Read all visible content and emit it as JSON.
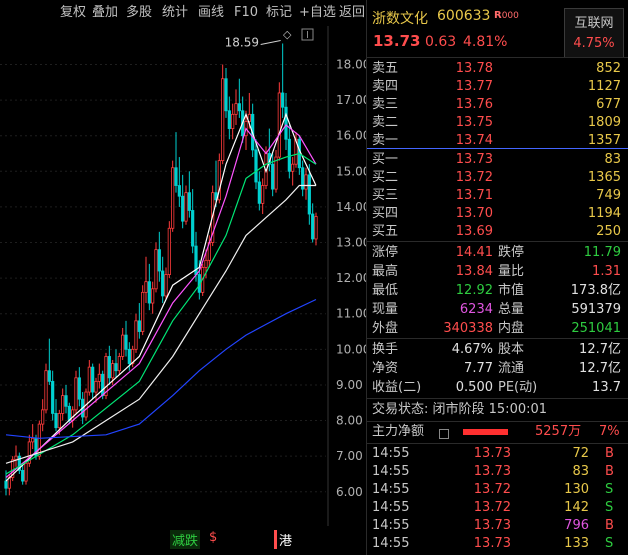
{
  "toolbar": {
    "items": [
      "复权",
      "叠加",
      "多股",
      "统计",
      "画线",
      "F10",
      "标记",
      "+自选",
      "返回"
    ]
  },
  "chart": {
    "max_label": "18.59",
    "y_ticks": [
      "18.00",
      "17.00",
      "16.00",
      "15.00",
      "14.00",
      "13.00",
      "12.00",
      "11.00",
      "10.00",
      "9.00",
      "8.00",
      "7.00",
      "6.00"
    ],
    "indicators": [
      "减跌",
      "$",
      "港"
    ]
  },
  "chart_data": {
    "type": "candlestick",
    "ylim": [
      5.6,
      18.8
    ],
    "ohlc": [
      [
        6.3,
        6.6,
        5.9,
        6.1
      ],
      [
        6.1,
        6.5,
        5.9,
        6.4
      ],
      [
        6.4,
        7.0,
        6.3,
        6.9
      ],
      [
        6.9,
        7.3,
        6.7,
        7.0
      ],
      [
        7.0,
        7.1,
        6.5,
        6.6
      ],
      [
        6.6,
        6.8,
        6.2,
        6.3
      ],
      [
        6.3,
        6.9,
        6.2,
        6.8
      ],
      [
        6.8,
        7.6,
        6.7,
        7.4
      ],
      [
        7.4,
        7.9,
        7.2,
        7.5
      ],
      [
        7.5,
        7.6,
        6.9,
        7.0
      ],
      [
        7.0,
        8.0,
        6.9,
        7.9
      ],
      [
        7.9,
        8.6,
        7.7,
        8.3
      ],
      [
        8.3,
        9.6,
        8.2,
        9.4
      ],
      [
        9.4,
        10.3,
        9.0,
        9.1
      ],
      [
        9.1,
        9.4,
        8.0,
        8.2
      ],
      [
        8.2,
        8.6,
        7.7,
        7.8
      ],
      [
        7.8,
        8.3,
        7.6,
        8.2
      ],
      [
        8.2,
        8.9,
        8.0,
        8.7
      ],
      [
        8.7,
        9.0,
        8.2,
        8.4
      ],
      [
        8.4,
        8.5,
        7.9,
        8.0
      ],
      [
        8.0,
        8.4,
        7.8,
        8.3
      ],
      [
        8.3,
        9.4,
        8.2,
        9.2
      ],
      [
        9.2,
        9.5,
        8.4,
        8.6
      ],
      [
        8.6,
        8.8,
        7.9,
        8.1
      ],
      [
        8.1,
        8.9,
        8.0,
        8.8
      ],
      [
        8.8,
        9.7,
        8.7,
        9.5
      ],
      [
        9.5,
        9.6,
        8.6,
        8.8
      ],
      [
        8.8,
        9.2,
        8.5,
        9.1
      ],
      [
        9.1,
        9.6,
        8.9,
        9.3
      ],
      [
        9.3,
        9.4,
        8.6,
        8.7
      ],
      [
        8.7,
        9.9,
        8.6,
        9.8
      ],
      [
        9.8,
        10.1,
        9.0,
        9.2
      ],
      [
        9.2,
        9.7,
        9.0,
        9.6
      ],
      [
        9.6,
        10.0,
        9.2,
        9.4
      ],
      [
        9.4,
        9.9,
        9.3,
        9.8
      ],
      [
        9.8,
        10.6,
        9.7,
        10.4
      ],
      [
        10.4,
        10.8,
        9.8,
        10.0
      ],
      [
        10.0,
        10.2,
        9.4,
        9.6
      ],
      [
        9.6,
        10.1,
        9.5,
        10.0
      ],
      [
        10.0,
        11.0,
        9.9,
        10.8
      ],
      [
        10.8,
        11.3,
        10.3,
        10.5
      ],
      [
        10.5,
        11.8,
        10.4,
        11.6
      ],
      [
        11.6,
        12.6,
        11.3,
        11.9
      ],
      [
        11.9,
        12.4,
        11.1,
        11.3
      ],
      [
        11.3,
        11.9,
        11.0,
        11.7
      ],
      [
        11.7,
        13.0,
        11.6,
        12.8
      ],
      [
        12.8,
        13.3,
        11.9,
        12.2
      ],
      [
        12.2,
        12.6,
        11.3,
        11.5
      ],
      [
        11.5,
        12.3,
        11.4,
        12.1
      ],
      [
        12.1,
        13.6,
        12.0,
        13.4
      ],
      [
        13.4,
        15.3,
        13.3,
        15.1
      ],
      [
        15.1,
        16.1,
        14.4,
        14.6
      ],
      [
        14.6,
        15.4,
        14.0,
        14.3
      ],
      [
        14.3,
        14.9,
        13.4,
        13.6
      ],
      [
        13.6,
        14.6,
        13.5,
        14.4
      ],
      [
        14.4,
        15.0,
        13.7,
        13.9
      ],
      [
        13.9,
        14.5,
        12.7,
        12.9
      ],
      [
        12.9,
        13.3,
        11.9,
        12.1
      ],
      [
        12.1,
        12.5,
        11.4,
        11.6
      ],
      [
        11.6,
        12.4,
        11.5,
        12.3
      ],
      [
        12.3,
        12.8,
        12.0,
        12.5
      ],
      [
        12.5,
        13.2,
        12.3,
        13.0
      ],
      [
        13.0,
        14.6,
        12.9,
        14.4
      ],
      [
        14.4,
        15.3,
        14.0,
        14.2
      ],
      [
        14.2,
        15.5,
        14.1,
        15.3
      ],
      [
        15.3,
        18.0,
        15.2,
        17.6
      ],
      [
        17.6,
        17.9,
        16.5,
        16.7
      ],
      [
        16.7,
        17.1,
        15.9,
        16.2
      ],
      [
        16.2,
        16.9,
        15.9,
        16.6
      ],
      [
        16.6,
        17.3,
        16.3,
        16.9
      ],
      [
        16.9,
        17.6,
        16.5,
        16.7
      ],
      [
        16.7,
        17.1,
        15.8,
        16.0
      ],
      [
        16.0,
        16.7,
        15.6,
        16.4
      ],
      [
        16.4,
        17.2,
        16.2,
        16.6
      ],
      [
        16.6,
        16.9,
        15.4,
        15.6
      ],
      [
        15.6,
        15.9,
        14.5,
        14.7
      ],
      [
        14.7,
        15.0,
        13.9,
        14.1
      ],
      [
        14.1,
        14.8,
        13.8,
        14.6
      ],
      [
        14.6,
        15.7,
        14.5,
        15.5
      ],
      [
        15.5,
        16.2,
        15.0,
        15.2
      ],
      [
        15.2,
        15.5,
        14.3,
        14.5
      ],
      [
        14.5,
        15.6,
        14.4,
        15.4
      ],
      [
        15.4,
        17.5,
        15.3,
        17.2
      ],
      [
        17.2,
        18.59,
        16.5,
        16.8
      ],
      [
        16.8,
        17.2,
        15.6,
        15.9
      ],
      [
        15.9,
        16.3,
        14.8,
        15.0
      ],
      [
        15.0,
        15.4,
        14.6,
        15.2
      ],
      [
        15.2,
        16.1,
        15.1,
        15.9
      ],
      [
        15.9,
        16.0,
        14.9,
        15.1
      ],
      [
        15.1,
        15.3,
        14.3,
        14.5
      ],
      [
        14.5,
        15.1,
        14.2,
        14.9
      ],
      [
        14.9,
        15.2,
        13.5,
        13.8
      ],
      [
        13.8,
        14.1,
        13.0,
        13.1
      ],
      [
        13.1,
        13.84,
        12.92,
        13.73
      ]
    ],
    "ma": [
      {
        "color": "#ffffff",
        "values": [
          [
            0,
            6.3
          ],
          [
            20,
            8.1
          ],
          [
            40,
            9.8
          ],
          [
            50,
            11.8
          ],
          [
            58,
            12.3
          ],
          [
            66,
            15.2
          ],
          [
            72,
            16.6
          ],
          [
            78,
            15.0
          ],
          [
            84,
            16.6
          ],
          [
            88,
            15.6
          ],
          [
            93,
            14.6
          ]
        ]
      },
      {
        "color": "#ff55ff",
        "values": [
          [
            0,
            6.4
          ],
          [
            20,
            8.0
          ],
          [
            40,
            9.6
          ],
          [
            50,
            11.3
          ],
          [
            58,
            12.2
          ],
          [
            66,
            14.3
          ],
          [
            72,
            16.2
          ],
          [
            78,
            15.5
          ],
          [
            84,
            16.3
          ],
          [
            88,
            16.0
          ],
          [
            93,
            15.2
          ]
        ]
      },
      {
        "color": "#00e676",
        "values": [
          [
            0,
            6.5
          ],
          [
            20,
            7.6
          ],
          [
            40,
            9.1
          ],
          [
            50,
            10.8
          ],
          [
            58,
            11.8
          ],
          [
            66,
            13.2
          ],
          [
            72,
            14.8
          ],
          [
            78,
            15.2
          ],
          [
            84,
            15.4
          ],
          [
            88,
            15.5
          ],
          [
            93,
            15.2
          ]
        ]
      },
      {
        "color": "#f0f0f0",
        "values": [
          [
            0,
            6.8
          ],
          [
            20,
            7.4
          ],
          [
            40,
            8.6
          ],
          [
            50,
            9.8
          ],
          [
            58,
            11.0
          ],
          [
            66,
            12.2
          ],
          [
            72,
            13.2
          ],
          [
            78,
            13.7
          ],
          [
            84,
            14.2
          ],
          [
            88,
            14.6
          ],
          [
            93,
            14.6
          ]
        ]
      },
      {
        "color": "#2244ff",
        "values": [
          [
            0,
            7.6
          ],
          [
            10,
            7.5
          ],
          [
            30,
            7.6
          ],
          [
            40,
            7.9
          ],
          [
            50,
            8.7
          ],
          [
            58,
            9.4
          ],
          [
            66,
            10.0
          ],
          [
            72,
            10.4
          ],
          [
            78,
            10.7
          ],
          [
            84,
            11.0
          ],
          [
            93,
            11.4
          ]
        ]
      }
    ]
  },
  "quote": {
    "name": "浙数文化",
    "code": "600633",
    "tag": "R",
    "tag2": "000",
    "industry": "互联网",
    "industry_pct": "4.75%",
    "price": "13.73",
    "change": "0.63",
    "pct": "4.81%",
    "sells": [
      {
        "label": "卖五",
        "price": "13.78",
        "vol": "852"
      },
      {
        "label": "卖四",
        "price": "13.77",
        "vol": "1127"
      },
      {
        "label": "卖三",
        "price": "13.76",
        "vol": "677"
      },
      {
        "label": "卖二",
        "price": "13.75",
        "vol": "1809"
      },
      {
        "label": "卖一",
        "price": "13.74",
        "vol": "1357"
      }
    ],
    "buys": [
      {
        "label": "买一",
        "price": "13.73",
        "vol": "83"
      },
      {
        "label": "买二",
        "price": "13.72",
        "vol": "1365"
      },
      {
        "label": "买三",
        "price": "13.71",
        "vol": "749"
      },
      {
        "label": "买四",
        "price": "13.70",
        "vol": "1194"
      },
      {
        "label": "买五",
        "price": "13.69",
        "vol": "250"
      }
    ],
    "stats1": [
      {
        "l1": "涨停",
        "v1": "14.41",
        "c1": "red",
        "l2": "跌停",
        "v2": "11.79",
        "c2": "green"
      },
      {
        "l1": "最高",
        "v1": "13.84",
        "c1": "red",
        "l2": "量比",
        "v2": "1.31",
        "c2": "red"
      },
      {
        "l1": "最低",
        "v1": "12.92",
        "c1": "green",
        "l2": "市值",
        "v2": "173.8亿",
        "c2": "white"
      },
      {
        "l1": "现量",
        "v1": "6234",
        "c1": "mag",
        "l2": "总量",
        "v2": "591379",
        "c2": "white"
      },
      {
        "l1": "外盘",
        "v1": "340338",
        "c1": "red",
        "l2": "内盘",
        "v2": "251041",
        "c2": "green"
      }
    ],
    "stats2": [
      {
        "l1": "换手",
        "v1": "4.67%",
        "l2": "股本",
        "v2": "12.7亿"
      },
      {
        "l1": "净资",
        "v1": "7.77",
        "l2": "流通",
        "v2": "12.7亿"
      },
      {
        "l1": "收益(二)",
        "v1": "0.500",
        "l2": "PE(动)",
        "v2": "13.7"
      }
    ],
    "status": "交易状态: 闭市阶段 15:00:01",
    "flow_label": "主力净额",
    "flow_value": "5257万",
    "flow_pct": "7%",
    "ticks": [
      {
        "time": "14:55",
        "price": "13.73",
        "vol": "72",
        "side": "B"
      },
      {
        "time": "14:55",
        "price": "13.73",
        "vol": "83",
        "side": "B"
      },
      {
        "time": "14:55",
        "price": "13.72",
        "vol": "130",
        "side": "S"
      },
      {
        "time": "14:55",
        "price": "13.72",
        "vol": "142",
        "side": "S"
      },
      {
        "time": "14:55",
        "price": "13.73",
        "vol": "796",
        "side": "B"
      },
      {
        "time": "14:55",
        "price": "13.73",
        "vol": "133",
        "side": "S"
      }
    ]
  }
}
